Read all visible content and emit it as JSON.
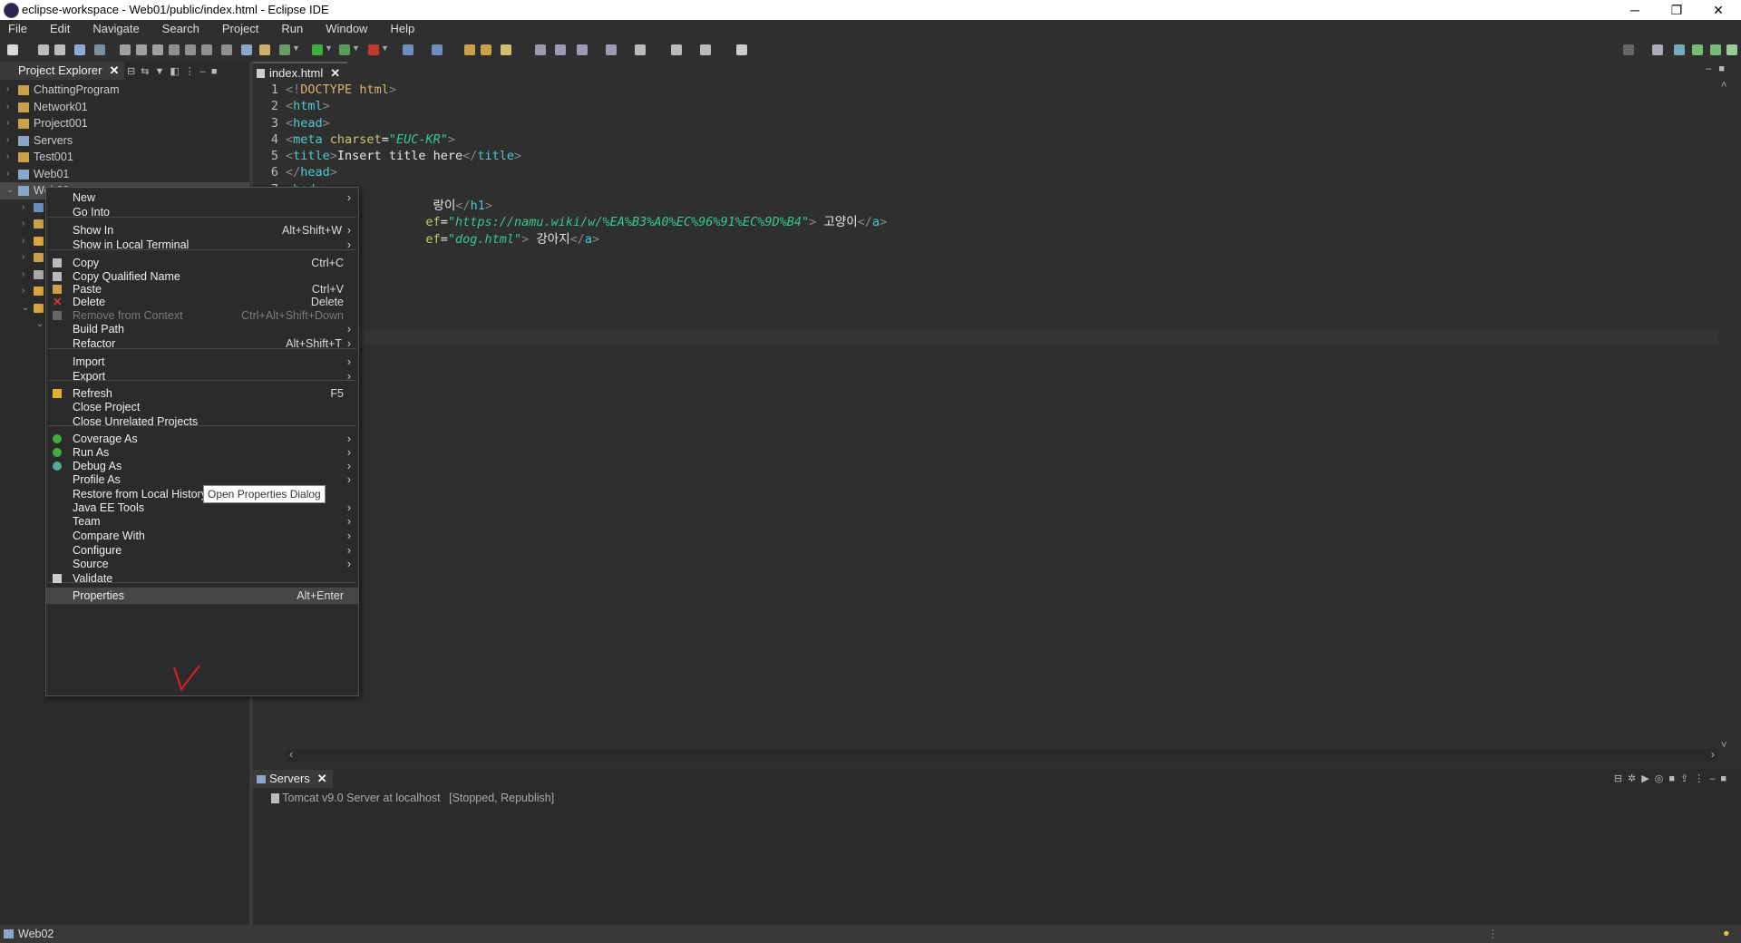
{
  "window": {
    "title": "eclipse-workspace - Web01/public/index.html - Eclipse IDE",
    "controls": [
      "─",
      "❐",
      "✕"
    ]
  },
  "menubar": [
    "File",
    "Edit",
    "Navigate",
    "Search",
    "Project",
    "Run",
    "Window",
    "Help"
  ],
  "project_explorer": {
    "tab_label": "Project Explorer",
    "projects": [
      "ChattingProgram",
      "Network01",
      "Project001",
      "Servers",
      "Test001",
      "Web01",
      "Web02"
    ]
  },
  "editor": {
    "tab_label": "index.html",
    "lines": [
      {
        "n": "1",
        "tokens": [
          [
            "brk",
            "<!"
          ],
          [
            "doc",
            "DOCTYPE"
          ],
          [
            "txt",
            " "
          ],
          [
            "doc",
            "html"
          ],
          [
            "brk",
            ">"
          ]
        ]
      },
      {
        "n": "2",
        "tokens": [
          [
            "brk",
            "<"
          ],
          [
            "tag",
            "html"
          ],
          [
            "brk",
            ">"
          ]
        ]
      },
      {
        "n": "3",
        "tokens": [
          [
            "brk",
            "<"
          ],
          [
            "tag",
            "head"
          ],
          [
            "brk",
            ">"
          ]
        ]
      },
      {
        "n": "4",
        "tokens": [
          [
            "brk",
            "<"
          ],
          [
            "tag",
            "meta"
          ],
          [
            "txt",
            " "
          ],
          [
            "attr",
            "charset"
          ],
          [
            "txt",
            "="
          ],
          [
            "val",
            "\"EUC-KR\""
          ],
          [
            "brk",
            ">"
          ]
        ]
      },
      {
        "n": "5",
        "tokens": [
          [
            "brk",
            "<"
          ],
          [
            "tag",
            "title"
          ],
          [
            "brk",
            ">"
          ],
          [
            "txt",
            "Insert title here"
          ],
          [
            "brk",
            "</"
          ],
          [
            "tag",
            "title"
          ],
          [
            "brk",
            ">"
          ]
        ]
      },
      {
        "n": "6",
        "tokens": [
          [
            "brk",
            "</"
          ],
          [
            "tag",
            "head"
          ],
          [
            "brk",
            ">"
          ]
        ]
      },
      {
        "n": "7",
        "tokens": [
          [
            "brk",
            "<"
          ],
          [
            "tag",
            "body"
          ],
          [
            "brk",
            ">"
          ]
        ]
      },
      {
        "n": "",
        "tokens": [
          [
            "txt",
            "                    랑이"
          ],
          [
            "brk",
            "</"
          ],
          [
            "tag",
            "h1"
          ],
          [
            "brk",
            ">"
          ]
        ]
      },
      {
        "n": "",
        "tokens": [
          [
            "attr",
            "                   ef"
          ],
          [
            "txt",
            "="
          ],
          [
            "val",
            "\"https://namu.wiki/w/%EA%B3%A0%EC%96%91%EC%9D%B4\""
          ],
          [
            "brk",
            ">"
          ],
          [
            "txt",
            " 고양이"
          ],
          [
            "brk",
            "</"
          ],
          [
            "tag",
            "a"
          ],
          [
            "brk",
            ">"
          ]
        ]
      },
      {
        "n": "",
        "tokens": [
          [
            "attr",
            "                   ef"
          ],
          [
            "txt",
            "="
          ],
          [
            "val",
            "\"dog.html\""
          ],
          [
            "brk",
            ">"
          ],
          [
            "txt",
            " 강아지"
          ],
          [
            "brk",
            "</"
          ],
          [
            "tag",
            "a"
          ],
          [
            "brk",
            ">"
          ]
        ]
      }
    ]
  },
  "servers_view": {
    "tab_label": "Servers",
    "entries": [
      {
        "name": "Tomcat v9.0 Server at localhost",
        "state": "[Stopped, Republish]"
      }
    ]
  },
  "status_bar": {
    "selection": "Web02"
  },
  "context_menu": {
    "items": [
      {
        "label": "New",
        "shortcut": "",
        "submenu": true
      },
      {
        "label": "Go Into",
        "shortcut": "",
        "submenu": false
      },
      {
        "label": "Show In",
        "shortcut": "Alt+Shift+W",
        "submenu": true
      },
      {
        "label": "Show in Local Terminal",
        "shortcut": "",
        "submenu": true
      },
      {
        "label": "Copy",
        "shortcut": "Ctrl+C",
        "submenu": false
      },
      {
        "label": "Copy Qualified Name",
        "shortcut": "",
        "submenu": false
      },
      {
        "label": "Paste",
        "shortcut": "Ctrl+V",
        "submenu": false
      },
      {
        "label": "Delete",
        "shortcut": "Delete",
        "submenu": false
      },
      {
        "label": "Remove from Context",
        "shortcut": "Ctrl+Alt+Shift+Down",
        "submenu": false
      },
      {
        "label": "Build Path",
        "shortcut": "",
        "submenu": true
      },
      {
        "label": "Refactor",
        "shortcut": "Alt+Shift+T",
        "submenu": true
      },
      {
        "label": "Import",
        "shortcut": "",
        "submenu": true
      },
      {
        "label": "Export",
        "shortcut": "",
        "submenu": true
      },
      {
        "label": "Refresh",
        "shortcut": "F5",
        "submenu": false
      },
      {
        "label": "Close Project",
        "shortcut": "",
        "submenu": false
      },
      {
        "label": "Close Unrelated Projects",
        "shortcut": "",
        "submenu": false
      },
      {
        "label": "Coverage As",
        "shortcut": "",
        "submenu": true
      },
      {
        "label": "Run As",
        "shortcut": "",
        "submenu": true
      },
      {
        "label": "Debug As",
        "shortcut": "",
        "submenu": true
      },
      {
        "label": "Profile As",
        "shortcut": "",
        "submenu": true
      },
      {
        "label": "Restore from Local History...",
        "shortcut": "",
        "submenu": false
      },
      {
        "label": "Java EE Tools",
        "shortcut": "",
        "submenu": true
      },
      {
        "label": "Team",
        "shortcut": "",
        "submenu": true
      },
      {
        "label": "Compare With",
        "shortcut": "",
        "submenu": true
      },
      {
        "label": "Configure",
        "shortcut": "",
        "submenu": true
      },
      {
        "label": "Source",
        "shortcut": "",
        "submenu": true
      },
      {
        "label": "Validate",
        "shortcut": "",
        "submenu": false
      },
      {
        "label": "Properties",
        "shortcut": "Alt+Enter",
        "submenu": false
      }
    ],
    "tooltip": "Open Properties Dialog"
  },
  "colors": {
    "background": "#2f2f2f",
    "tag": "#4ec9d0",
    "attribute": "#c8c86a",
    "value": "#36c88f",
    "annotation_check": "#e02020"
  }
}
